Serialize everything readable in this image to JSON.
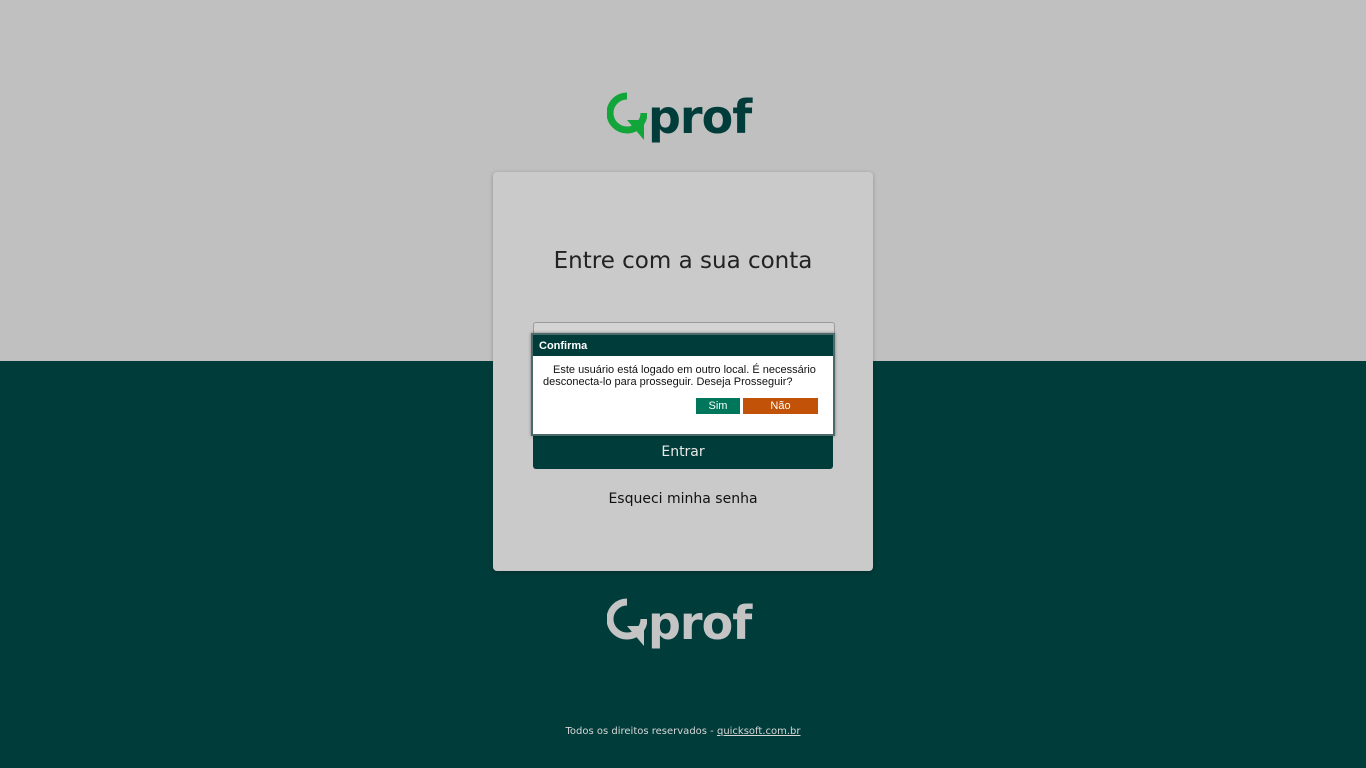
{
  "brand": {
    "logo_text": "prof",
    "mark_color": "#11a53a",
    "primary_color": "#003c3a",
    "top_background": "#c0c0c0",
    "bottom_background": "#003c3a"
  },
  "login": {
    "title": "Entre com a sua conta",
    "submit_label": "Entrar",
    "forgot_password_label": "Esqueci minha senha"
  },
  "dialog": {
    "title": "Confirma",
    "message": "Este usuário está logado em outro local. É necessário desconecta-lo para prosseguir. Deseja Prosseguir?",
    "yes_label": "Sim",
    "no_label": "Não",
    "yes_color": "#00775a",
    "no_color": "#c25208"
  },
  "footer": {
    "text": "Todos os direitos reservados - ",
    "link_text": "quicksoft.com.br"
  }
}
